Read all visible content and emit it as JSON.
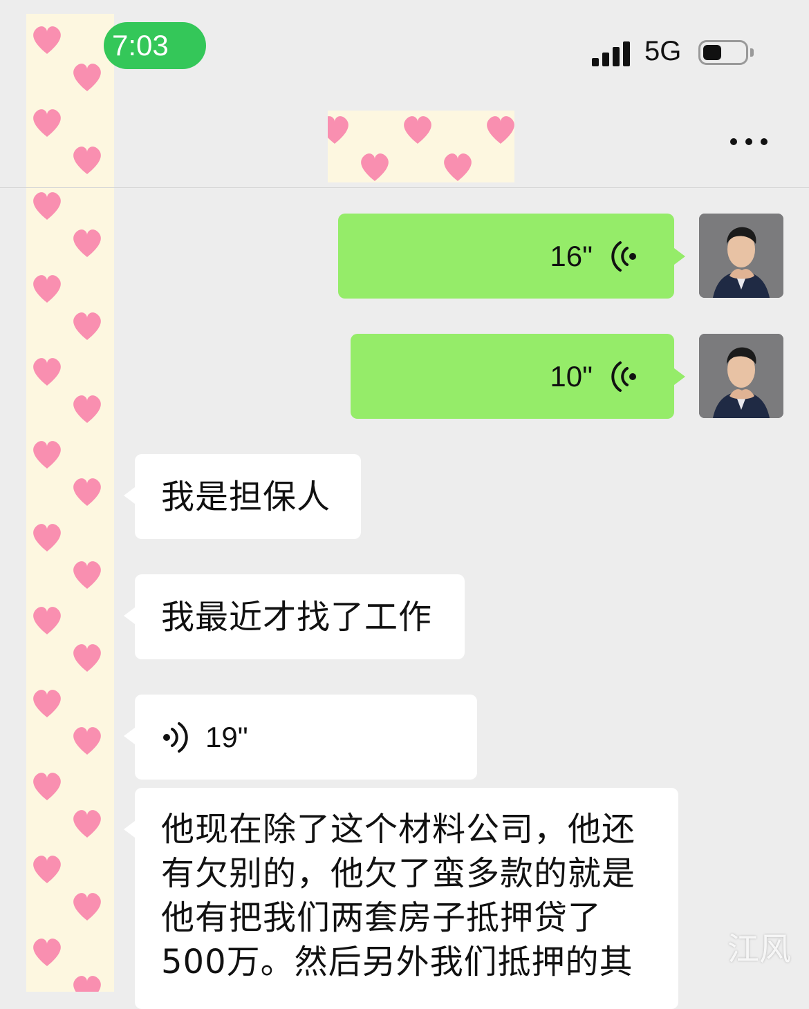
{
  "status_bar": {
    "time": "7:03",
    "network": "5G",
    "battery_level": 0.45,
    "signal_bars": 4
  },
  "nav": {
    "more_icon": "more-dots-icon"
  },
  "messages": [
    {
      "direction": "out",
      "type": "voice",
      "duration": "16\"",
      "icon": "voice-wave-icon"
    },
    {
      "direction": "out",
      "type": "voice",
      "duration": "10\"",
      "icon": "voice-wave-icon"
    },
    {
      "direction": "in",
      "type": "text",
      "text": "我是担保人"
    },
    {
      "direction": "in",
      "type": "text",
      "text": "我最近才找了工作"
    },
    {
      "direction": "in",
      "type": "voice",
      "duration": "19\"",
      "icon": "voice-wave-icon"
    },
    {
      "direction": "in",
      "type": "text",
      "lines": [
        "他现在除了这个材料公司，他还",
        "有欠别的，他欠了蛮多款的就是",
        "他有把我们两套房子抵押贷了",
        "500万。然后另外我们抵押的其"
      ]
    }
  ],
  "watermark": "江风",
  "colors": {
    "background": "#ededed",
    "outgoing_bubble": "#95ec69",
    "incoming_bubble": "#ffffff",
    "time_pill": "#34c759"
  }
}
